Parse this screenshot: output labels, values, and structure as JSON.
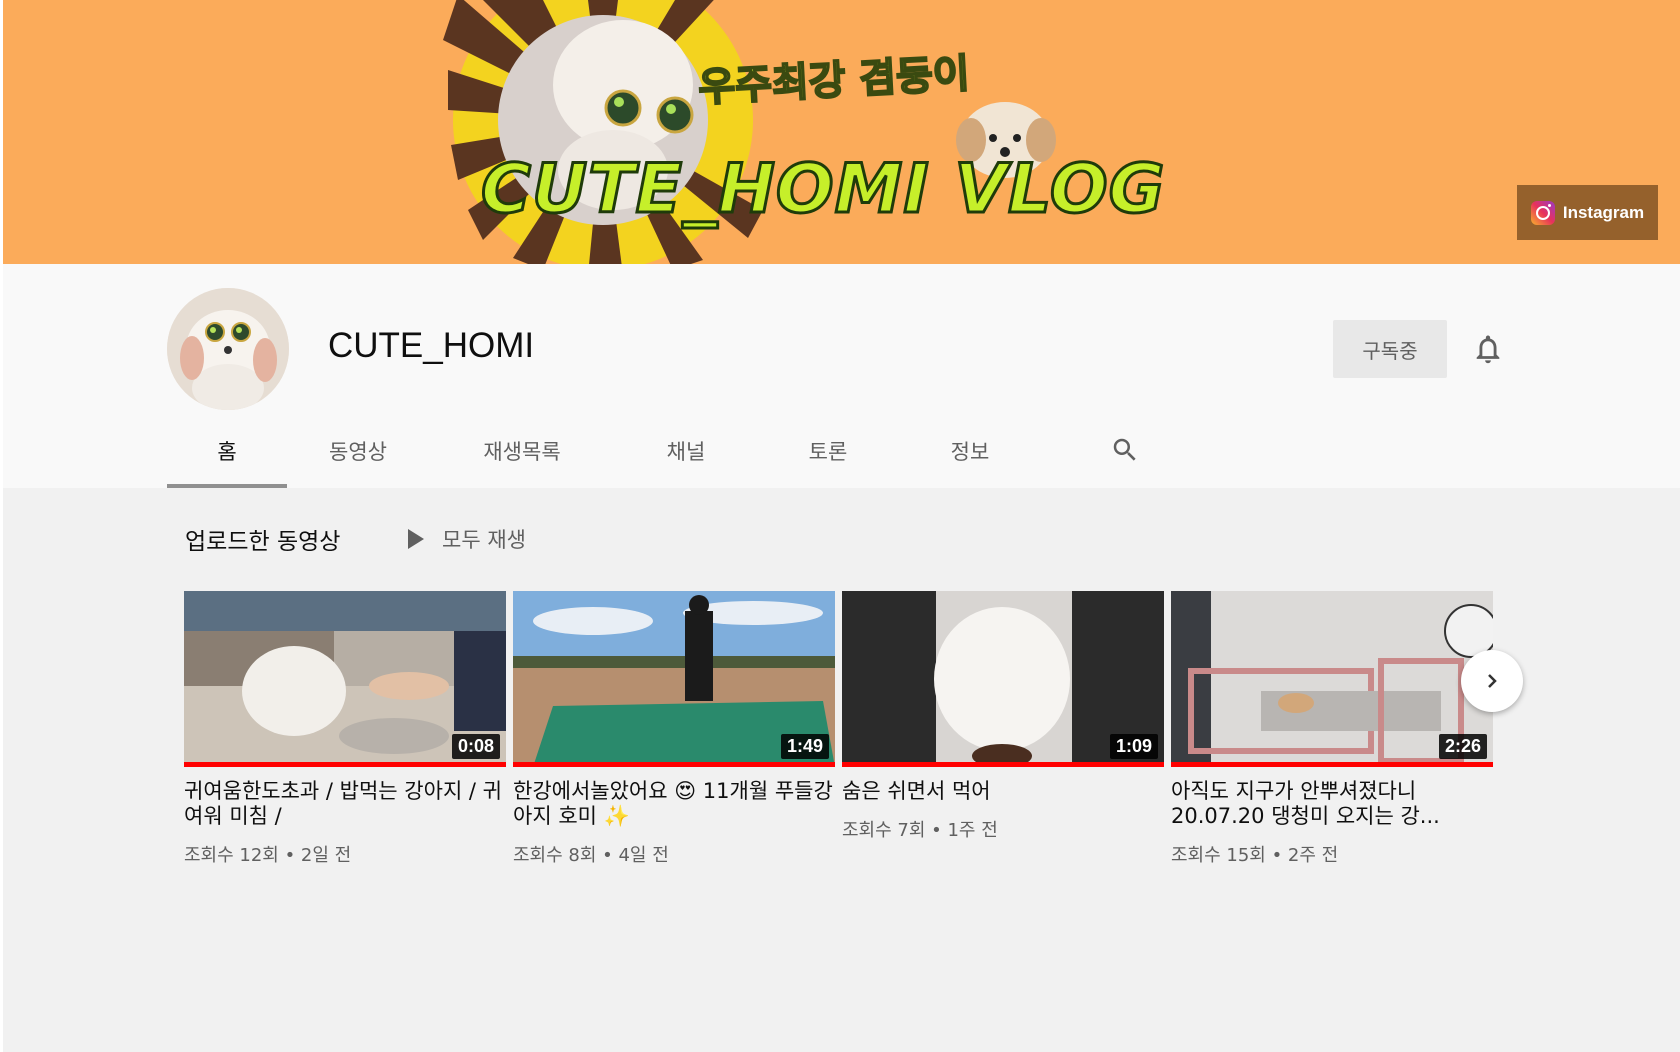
{
  "banner": {
    "subtitle": "우주최강 겸둥이",
    "title": "CUTE_HOMI VLOG",
    "link_label": "Instagram",
    "link_icon": "instagram-icon",
    "bg_color": "#fbab5a"
  },
  "channel": {
    "name": "CUTE_HOMI",
    "subscribe_label": "구독중",
    "bell_icon": "bell-icon"
  },
  "tabs": [
    {
      "label": "홈",
      "active": true
    },
    {
      "label": "동영상"
    },
    {
      "label": "재생목록"
    },
    {
      "label": "채널"
    },
    {
      "label": "토론"
    },
    {
      "label": "정보"
    }
  ],
  "section": {
    "title": "업로드한 동영상",
    "play_all_label": "모두 재생"
  },
  "videos": [
    {
      "title": "귀여움한도초과 / 밥먹는 강아지 / 귀여워 미침 /",
      "meta": "조회수 12회 • 2일 전",
      "duration": "0:08",
      "watched": 1.0
    },
    {
      "title": "한강에서놀았어요 😍 11개월 푸들강아지 호미 ✨",
      "meta": "조회수 8회 • 4일 전",
      "duration": "1:49",
      "watched": 1.0
    },
    {
      "title": "숨은 쉬면서 먹어",
      "meta": "조회수 7회 • 1주 전",
      "duration": "1:09",
      "watched": 1.0
    },
    {
      "title": "아직도 지구가 안뿌셔졌다니 20.07.20 댕청미 오지는 강...",
      "meta": "조회수 15회 • 2주 전",
      "duration": "2:26",
      "watched": 1.0
    }
  ],
  "accent_color": "#ff0000"
}
